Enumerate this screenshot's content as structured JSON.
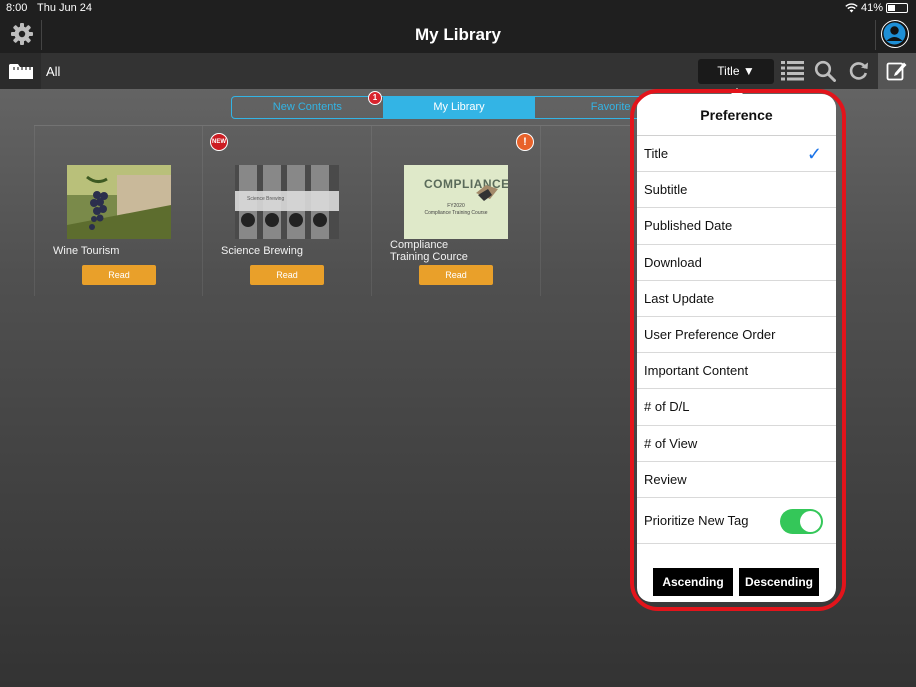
{
  "status": {
    "time": "8:00",
    "date": "Thu Jun 24",
    "battery": "41%",
    "battery_level": 0.41
  },
  "app": {
    "title": "My Library"
  },
  "toolbar": {
    "folder_label": "All",
    "sort_label": "Title ▼"
  },
  "tabs": [
    {
      "label": "New Contents",
      "active": false
    },
    {
      "label": "My Library",
      "active": true
    },
    {
      "label": "Favorite",
      "active": false
    }
  ],
  "tab_badge": "1",
  "books": [
    {
      "title": "Wine Tourism",
      "read_label": "Read",
      "badge": ""
    },
    {
      "title": "Science Brewing",
      "read_label": "Read",
      "badge": "NEW",
      "cover_text": "Science Brewing"
    },
    {
      "title": "Compliance\nTraining Cource",
      "read_label": "Read",
      "badge": "!",
      "cover_title": "COMPLIANCE",
      "cover_sub1": "FY2020",
      "cover_sub2": "Compliance Training Course"
    }
  ],
  "preference": {
    "title": "Preference",
    "options": [
      {
        "label": "Title",
        "checked": true
      },
      {
        "label": "Subtitle",
        "checked": false
      },
      {
        "label": "Published Date",
        "checked": false
      },
      {
        "label": "Download",
        "checked": false
      },
      {
        "label": "Last Update",
        "checked": false
      },
      {
        "label": "User Preference Order",
        "checked": false
      },
      {
        "label": "Important Content",
        "checked": false
      },
      {
        "label": "# of D/L",
        "checked": false
      },
      {
        "label": "# of View",
        "checked": false
      },
      {
        "label": "Review",
        "checked": false
      }
    ],
    "check_mark": "✓",
    "prioritize_label": "Prioritize New Tag",
    "prioritize_on": true,
    "ascending_label": "Ascending",
    "descending_label": "Descending"
  },
  "colors": {
    "accent": "#33b4e5",
    "read_button": "#e9a02a",
    "toggle_on": "#34c759",
    "highlight_ring": "#e3141b"
  }
}
